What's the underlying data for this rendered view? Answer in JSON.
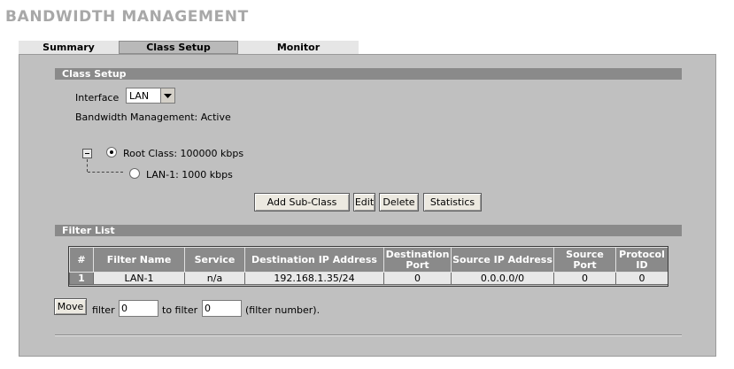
{
  "page": {
    "title": "BANDWIDTH MANAGEMENT"
  },
  "tabs": [
    {
      "label": "Summary"
    },
    {
      "label": "Class Setup"
    },
    {
      "label": "Monitor"
    }
  ],
  "class_setup": {
    "section_title": "Class Setup",
    "interface_label": "Interface",
    "interface_value": "LAN",
    "status_text": "Bandwidth Management: Active",
    "tree": {
      "root_label": "Root Class: 100000 kbps",
      "child_label": "LAN-1: 1000 kbps"
    },
    "buttons": {
      "add_sub_class": "Add Sub-Class",
      "edit": "Edit",
      "delete": "Delete",
      "statistics": "Statistics"
    }
  },
  "filter_list": {
    "section_title": "Filter List",
    "columns": [
      "#",
      "Filter Name",
      "Service",
      "Destination IP Address",
      "Destination Port",
      "Source IP Address",
      "Source Port",
      "Protocol ID"
    ],
    "rows": [
      {
        "num": "1",
        "filter_name": "LAN-1",
        "service": "n/a",
        "dest_ip": "192.168.1.35/24",
        "dest_port": "0",
        "src_ip": "0.0.0.0/0",
        "src_port": "0",
        "protocol_id": "0"
      }
    ],
    "move": {
      "button_label": "Move",
      "filter_label": "filter",
      "filter_value": "0",
      "to_filter_label": "to filter",
      "to_filter_value": "0",
      "hint": "(filter number)."
    }
  }
}
